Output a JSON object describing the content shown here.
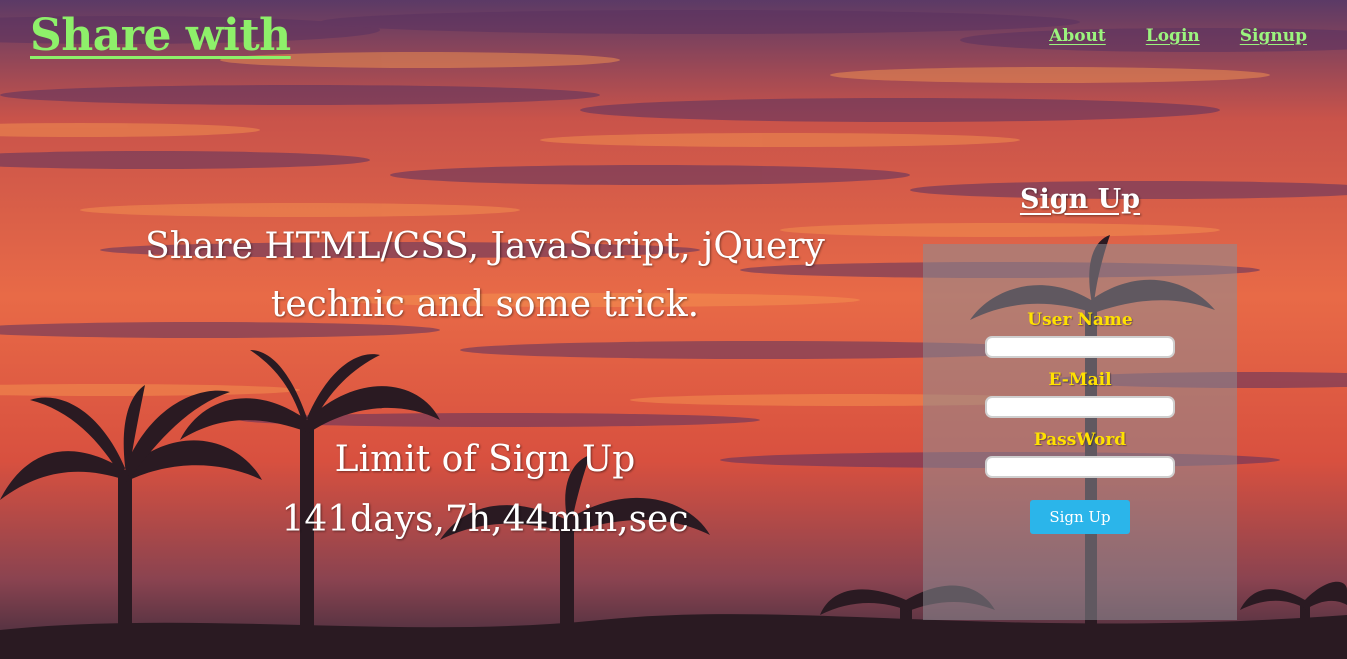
{
  "header": {
    "brand": "Share with",
    "nav": [
      {
        "label": "About"
      },
      {
        "label": "Login"
      },
      {
        "label": "Signup"
      }
    ]
  },
  "hero": {
    "tagline_line1": "Share HTML/CSS, JavaScript, jQuery",
    "tagline_line2": "technic and some trick.",
    "limit_title": "Limit of Sign Up",
    "countdown": "141days,7h,44min,sec"
  },
  "signup": {
    "title": "Sign Up",
    "fields": [
      {
        "label": "User Name",
        "value": "",
        "placeholder": ""
      },
      {
        "label": "E-Mail",
        "value": "",
        "placeholder": ""
      },
      {
        "label": "PassWord",
        "value": "",
        "placeholder": ""
      }
    ],
    "submit_label": "Sign Up"
  },
  "colors": {
    "brand": "#8ef06a",
    "nav_link": "#9bf47e",
    "field_label": "#ffe100",
    "submit_button": "#2bb5ea",
    "panel": "rgba(140,140,148,0.55)"
  }
}
